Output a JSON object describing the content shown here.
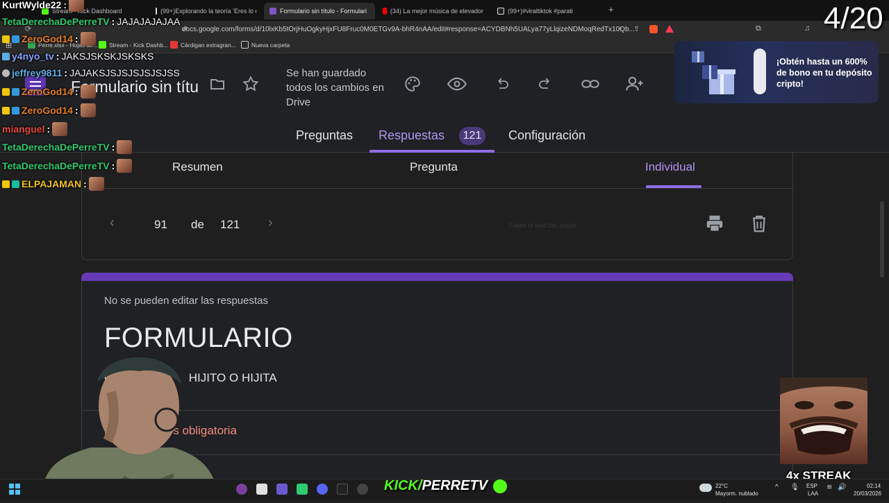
{
  "browser": {
    "tabs": [
      {
        "label": "Stream - Kick Dashboard"
      },
      {
        "label": "(99+)Explorando la teoría 'Eres lo qu"
      },
      {
        "label": "Formulario sin título - Formulari"
      },
      {
        "label": "(34) La mejor música de elevador"
      },
      {
        "label": "(99+)#viraltiktok #parati"
      }
    ],
    "url": "docs.google.com/forms/d/10lxKb5tOrjHuOgkyHjxFU8Fruc0M0ETGv9A-bhR4nAA/edit#response=ACYDBNh5UALya77yLlqizeNDMoqRedTx10Qb...",
    "bookmarks": [
      {
        "label": "Perre.xlsx - Hojas de..."
      },
      {
        "label": "Stream - Kick Dashb..."
      },
      {
        "label": "Cárdigan extragran..."
      },
      {
        "label": "Nueva carpeta"
      }
    ]
  },
  "forms": {
    "title": "Formulario sin títu",
    "saved_status": "Se han guardado todos los cambios en Drive",
    "tabs": {
      "questions": "Preguntas",
      "responses": "Respuestas",
      "responses_count": "121",
      "settings": "Configuración"
    },
    "subtabs": {
      "summary": "Resumen",
      "question": "Pregunta",
      "individual": "Individual"
    },
    "pager": {
      "current": "91",
      "of": "de",
      "total": "121"
    },
    "failed_text": "Failed to load file, playbl",
    "form": {
      "no_edit": "No se pueden editar las respuestas",
      "title": "FORMULARIO",
      "description": "C",
      "description_rest": "HIJITO O HIJITA",
      "required": "la pregunta es obligatoria"
    }
  },
  "overlay": {
    "counter": "4/20",
    "chat": [
      {
        "user": "KurtWylde22",
        "msg": "",
        "color": "#ffffff"
      },
      {
        "user": "TetaDerechaDePerreTV",
        "msg": "JAJAJAJAJAA",
        "color": "#2ecc71"
      },
      {
        "user": "ZeroGod14",
        "msg": "",
        "color": "#e67e22"
      },
      {
        "user": "y4nyo_tv",
        "msg": "JAKSJSKSKJSKSKS",
        "color": "#8aa0ff"
      },
      {
        "user": "jeffrey9811",
        "msg": "JAJAKSJSJSJSJSJSJSS",
        "color": "#5dade2"
      },
      {
        "user": "ZeroGod14",
        "msg": "",
        "color": "#e67e22"
      },
      {
        "user": "ZeroGod14",
        "msg": "",
        "color": "#e67e22"
      },
      {
        "user": "mianguel",
        "msg": "",
        "color": "#e74c3c"
      },
      {
        "user": "TetaDerechaDePerreTV",
        "msg": "",
        "color": "#2ecc71"
      },
      {
        "user": "TetaDerechaDePerreTV",
        "msg": "",
        "color": "#2ecc71"
      },
      {
        "user": "ELPAJAMAN",
        "msg": "",
        "color": "#f1c40f"
      }
    ],
    "ad_text": "¡Obtén hasta un 600% de bono en tu depósito cripto!",
    "streak": "4x STREAK",
    "kick_prefix": "KICK/",
    "kick_name": "PERRETV"
  },
  "taskbar": {
    "weather_temp": "22°C",
    "weather_desc": "Mayorm. nublado",
    "lang1": "ESP",
    "lang2": "LAA",
    "time": "02:14",
    "date": "20/03/2026"
  },
  "colors": {
    "accent": "#b195f5",
    "form_bar": "#673ab7",
    "error": "#f28b82",
    "kick_green": "#53fc18"
  }
}
